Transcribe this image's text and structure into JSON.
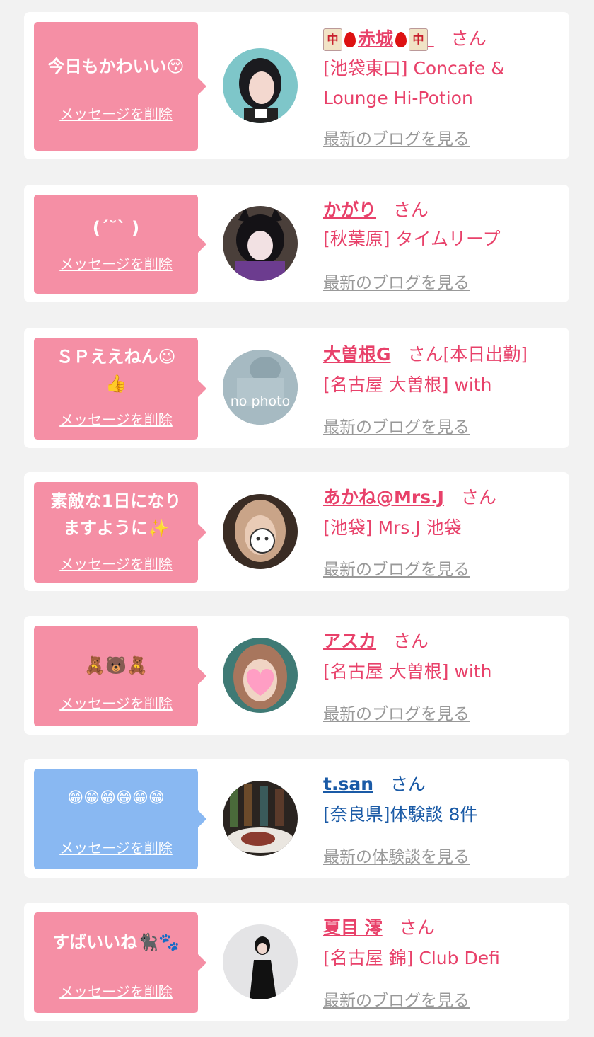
{
  "cards": [
    {
      "message": "今日もかわいい😚",
      "delete_label": "メッセージを削除",
      "name": "赤城",
      "name_prefix_icons": [
        "mahjong-tile-icon",
        "blood-drop-icon"
      ],
      "name_suffix_icons": [
        "blood-drop-icon",
        "mahjong-tile-icon"
      ],
      "honorific": "さん",
      "shop": "[池袋東口] Concafe & Lounge Hi-Potion",
      "link": "最新のブログを見る"
    },
    {
      "message": "(ˊ˘ˋ )",
      "delete_label": "メッセージを削除",
      "name": "かがり",
      "honorific": "さん",
      "shop": "[秋葉原] タイムリープ",
      "link": "最新のブログを見る"
    },
    {
      "message": "ＳＰええねん😉👍",
      "delete_label": "メッセージを削除",
      "name": "大曽根G",
      "honorific": "さん",
      "status": "[本日出勤]",
      "shop": "[名古屋 大曽根] with",
      "link": "最新のブログを見る",
      "avatar_text": "no photo"
    },
    {
      "message": "素敵な1日になりますように✨",
      "delete_label": "メッセージを削除",
      "name": "あかね@Mrs.J",
      "honorific": "さん",
      "shop": "[池袋] Mrs.J 池袋",
      "link": "最新のブログを見る"
    },
    {
      "message": "🧸🐻🧸",
      "delete_label": "メッセージを削除",
      "name": "アスカ",
      "honorific": "さん",
      "shop": "[名古屋 大曽根] with",
      "link": "最新のブログを見る"
    },
    {
      "message": "😁😁😁😁😁😁",
      "delete_label": "メッセージを削除",
      "name": "t.san",
      "honorific": "さん",
      "shop": "[奈良県]体験談 8件",
      "link": "最新の体験談を見る"
    },
    {
      "message": "すばいいね🐈‍⬛🐾",
      "delete_label": "メッセージを削除",
      "name": "夏目 澪",
      "honorific": "さん",
      "shop": "[名古屋 錦] Club Defi",
      "link": "最新のブログを見る"
    }
  ],
  "colors": {
    "background": "#f2f2f2",
    "pink_bubble": "#f58fa5",
    "blue_bubble": "#89b8f2",
    "pink_text": "#e8416a",
    "blue_text": "#1a5aa6",
    "link_gray": "#999999"
  }
}
